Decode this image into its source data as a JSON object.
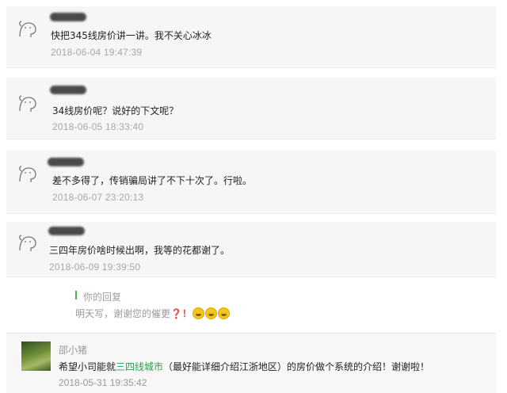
{
  "comments": [
    {
      "text": "快把345线房价讲一讲。我不关心冰冰",
      "time": "2018-06-04 19:47:39"
    },
    {
      "text": "34线房价呢？说好的下文呢？",
      "time": "2018-06-05 18:33:40"
    },
    {
      "text": "差不多得了，传销骗局讲了不下十次了。行啦。",
      "time": "2018-06-07 23:20:13"
    },
    {
      "text": "三四年房价啥时候出啊，我等的花都谢了。",
      "time": "2018-06-09 19:39:50"
    }
  ],
  "reply": {
    "label": "你的回复",
    "text": "明天写，谢谢您的催更",
    "mark": "❓！"
  },
  "bottom_comment": {
    "name": "邵小猪",
    "text_before": "希望小司能就",
    "link_text": "三四线城市",
    "text_after": "（最好能详细介绍江浙地区）的房价做个系统的介绍！谢谢啦！",
    "time": "2018-05-31 19:35:42"
  },
  "colors": {
    "accent": "#4caf50",
    "link": "#2e9e4a",
    "question_mark": "#d9534f"
  }
}
